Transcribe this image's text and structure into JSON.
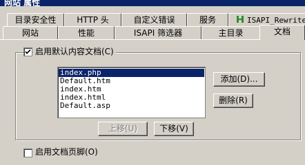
{
  "window": {
    "title": "网站 属性"
  },
  "tabs_row1": [
    {
      "label": "目录安全性"
    },
    {
      "label": "HTTP 头"
    },
    {
      "label": "自定义错误"
    },
    {
      "label": "服务"
    },
    {
      "label": "ISAPI_Rewrite",
      "icon": "isapi-rewrite-icon"
    }
  ],
  "tabs_row2": [
    {
      "label": "网站"
    },
    {
      "label": "性能"
    },
    {
      "label": "ISAPI 筛选器"
    },
    {
      "label": "主目录"
    },
    {
      "label": "文档",
      "active": true
    }
  ],
  "default_doc": {
    "enable_label": "启用默认内容文档(C)",
    "enabled": true,
    "documents": [
      "index.php",
      "Default.htm",
      "index.htm",
      "index.html",
      "Default.asp"
    ],
    "selected_index": 0,
    "add_button": "添加(D)...",
    "remove_button": "删除(R)",
    "move_up_button": "上移(U)",
    "move_down_button": "下移(V)"
  },
  "footer": {
    "enable_footer_label": "启用文档页脚(O)",
    "enabled": false
  },
  "colors": {
    "selection": "#0a246a",
    "face": "#d4d0c8",
    "accent_icon": "#2e8b2e"
  }
}
